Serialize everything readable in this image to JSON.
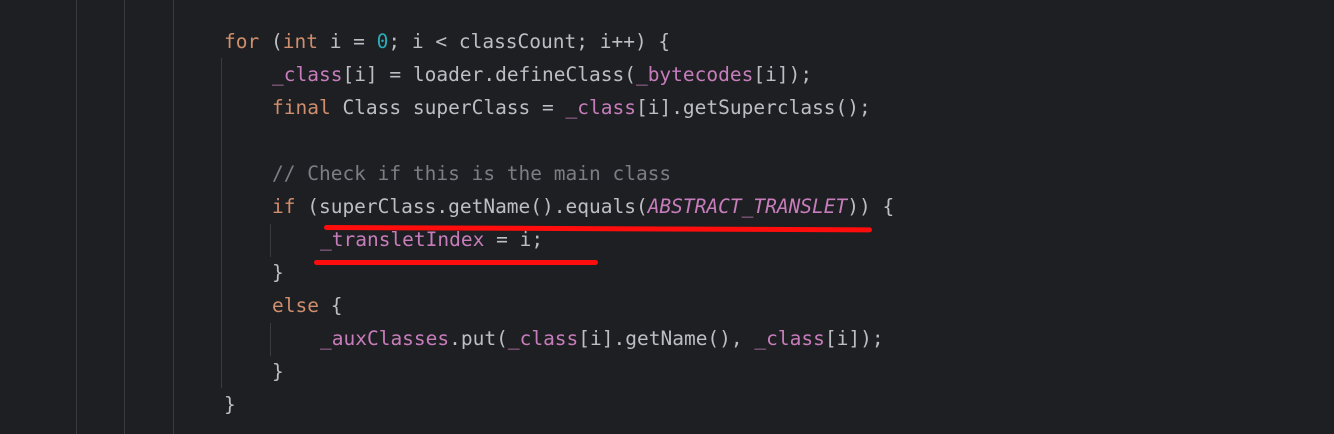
{
  "code": {
    "lines": [
      {
        "tokens": [
          {
            "t": "for",
            "c": "kw"
          },
          {
            "t": " (",
            "c": "plain"
          },
          {
            "t": "int",
            "c": "kw"
          },
          {
            "t": " i = ",
            "c": "plain"
          },
          {
            "t": "0",
            "c": "num"
          },
          {
            "t": "; i < classCount; i++) {",
            "c": "plain"
          }
        ]
      },
      {
        "tokens": [
          {
            "t": "_class",
            "c": "fld"
          },
          {
            "t": "[i] = loader.defineClass(",
            "c": "plain"
          },
          {
            "t": "_bytecodes",
            "c": "fld"
          },
          {
            "t": "[i]);",
            "c": "plain"
          }
        ]
      },
      {
        "tokens": [
          {
            "t": "final",
            "c": "kw"
          },
          {
            "t": " Class superClass = ",
            "c": "plain"
          },
          {
            "t": "_class",
            "c": "fld"
          },
          {
            "t": "[i].getSuperclass();",
            "c": "plain"
          }
        ]
      },
      {
        "tokens": []
      },
      {
        "tokens": [
          {
            "t": "// Check if this is the main class",
            "c": "cmt"
          }
        ]
      },
      {
        "tokens": [
          {
            "t": "if",
            "c": "kw"
          },
          {
            "t": " (superClass.getName().equals(",
            "c": "plain"
          },
          {
            "t": "ABSTRACT_TRANSLET",
            "c": "cst"
          },
          {
            "t": ")) {",
            "c": "plain"
          }
        ]
      },
      {
        "tokens": [
          {
            "t": "_transletIndex",
            "c": "fld"
          },
          {
            "t": " = i;",
            "c": "plain"
          }
        ]
      },
      {
        "tokens": [
          {
            "t": "}",
            "c": "plain"
          }
        ]
      },
      {
        "tokens": [
          {
            "t": "else",
            "c": "kw"
          },
          {
            "t": " {",
            "c": "plain"
          }
        ]
      },
      {
        "tokens": [
          {
            "t": "_auxClasses",
            "c": "fld"
          },
          {
            "t": ".put(",
            "c": "plain"
          },
          {
            "t": "_class",
            "c": "fld"
          },
          {
            "t": "[i].getName(), ",
            "c": "plain"
          },
          {
            "t": "_class",
            "c": "fld"
          },
          {
            "t": "[i]);",
            "c": "plain"
          }
        ]
      },
      {
        "tokens": [
          {
            "t": "}",
            "c": "plain"
          }
        ]
      },
      {
        "tokens": [
          {
            "t": "}",
            "c": "plain"
          }
        ]
      }
    ]
  },
  "colors": {
    "background": "#1e1f22",
    "keyword": "#cf8e6d",
    "number": "#2aacb8",
    "field": "#c77dbb",
    "comment": "#7a7e85",
    "text": "#bcbec4",
    "annotation": "#ff0d0d"
  }
}
